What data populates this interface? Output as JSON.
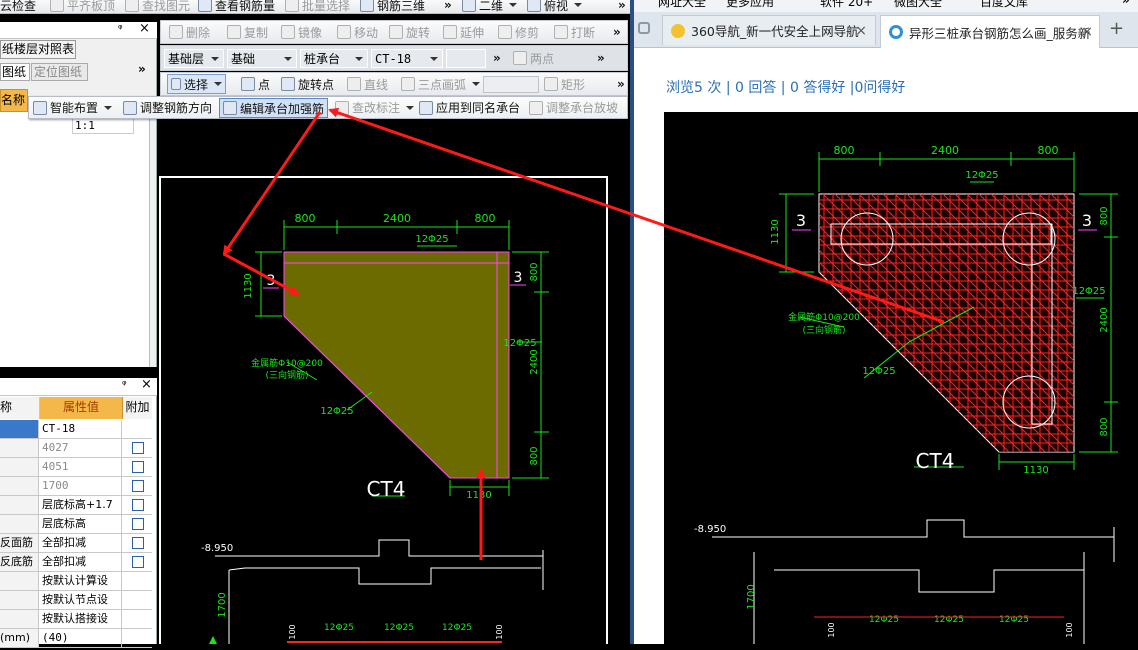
{
  "left_app": {
    "top_toolbar": {
      "items": [
        "云检查",
        "平齐板顶",
        "查找图元",
        "查看钢筋量",
        "批量选择",
        "钢筋三维",
        "二维",
        "俯视"
      ],
      "more": "»"
    },
    "edit_toolbar": {
      "items": [
        "删除",
        "复制",
        "镜像",
        "移动",
        "旋转",
        "延伸",
        "修剪",
        "打断"
      ],
      "more": "»"
    },
    "selector_bar": {
      "floor": "基础层",
      "category": "基础",
      "element_type": "桩承台",
      "element_name": "CT-18",
      "extra_value": "",
      "two_point": "两点",
      "more": "»"
    },
    "draw_toolbar": {
      "items": [
        "选择",
        "点",
        "旋转点",
        "直线",
        "三点画弧",
        "矩形"
      ],
      "more": "»"
    },
    "popup_toolbar": {
      "items": [
        "智能布置",
        "调整钢筋方向",
        "编辑承台加强筋",
        "查改标注",
        "应用到同名承台",
        "调整承台放坡"
      ],
      "highlighted_index": 2
    },
    "left_panel_top": {
      "pin": "ᵠ",
      "close": "×",
      "title": "纸楼层对照表",
      "tabs": [
        "图纸",
        "定位图纸"
      ],
      "more": "»",
      "column_header": "名称",
      "row_value": "1:1"
    },
    "property_panel": {
      "pin": "ᵠ",
      "close": "×",
      "headers": [
        "称",
        "属性值",
        "附加"
      ],
      "rows": [
        {
          "name": "",
          "value": "CT-18",
          "gray": false,
          "checkbox": false,
          "selected": true
        },
        {
          "name": "",
          "value": "4027",
          "gray": true,
          "checkbox": true
        },
        {
          "name": "",
          "value": "4051",
          "gray": true,
          "checkbox": true
        },
        {
          "name": "",
          "value": "1700",
          "gray": true,
          "checkbox": true
        },
        {
          "name": "",
          "value": "层底标高+1.7",
          "gray": false,
          "checkbox": true
        },
        {
          "name": "",
          "value": "层底标高",
          "gray": false,
          "checkbox": true
        },
        {
          "name": "反面筋",
          "value": "全部扣减",
          "gray": false,
          "checkbox": true
        },
        {
          "name": "反底筋",
          "value": "全部扣减",
          "gray": false,
          "checkbox": true
        },
        {
          "name": "",
          "value": "按默认计算设",
          "gray": false,
          "checkbox": false
        },
        {
          "name": "",
          "value": "按默认节点设",
          "gray": false,
          "checkbox": false
        },
        {
          "name": "",
          "value": "按默认搭接设",
          "gray": false,
          "checkbox": false
        },
        {
          "name": "(mm)",
          "value": "(40)",
          "gray": false,
          "checkbox": false
        }
      ]
    },
    "cad": {
      "dims_top": [
        "800",
        "2400",
        "800"
      ],
      "dim_left": "1130",
      "dim_right_top": "800",
      "dim_right_mid": "2400",
      "dim_right_bottom": "800",
      "dim_bottom": "1130",
      "bar_top": "12Φ25",
      "bar_right": "12Φ25",
      "bar_diag": "12Φ25",
      "mesh_note_1": "金属筋Φ10@200",
      "mesh_note_2": "(三向钢筋)",
      "marker": "3",
      "title": "CT4",
      "elev": "-8.950",
      "dim_vertical": "1700",
      "bar_b1": "12Φ25",
      "bar_b2": "12Φ25",
      "bar_b3": "12Φ25",
      "small_100": "100"
    }
  },
  "browser": {
    "toolbar_items": [
      "网址大全",
      "更多应用",
      "软件 20+",
      "微图大全",
      "百度文库"
    ],
    "more": "»",
    "tabs": [
      {
        "title": "360导航_新一代安全上网导航",
        "close": "×",
        "active": false
      },
      {
        "title": "异形三桩承台钢筋怎么画_服务新",
        "close": "×",
        "active": true
      }
    ],
    "new_tab": "+",
    "stats": {
      "views": "浏览5 次",
      "answers": "0 回答",
      "good": "0 答得好",
      "ask_good": "0问得好",
      "sep": "|"
    },
    "cad": {
      "dims_top": [
        "800",
        "2400",
        "800"
      ],
      "dim_left": "1130",
      "dim_right_top": "800",
      "dim_right_mid": "2400",
      "dim_right_bottom": "800",
      "dim_bottom": "1130",
      "bar_top": "12Φ25",
      "bar_right": "12Φ25",
      "bar_diag": "12Φ25",
      "mesh_note_1": "金属筋Φ10@200",
      "mesh_note_2": "(三向钢筋)",
      "marker": "3",
      "title": "CT4",
      "elev": "-8.950",
      "dim_vertical": "1700",
      "bar_b1": "12Φ25",
      "bar_b2": "12Φ25",
      "bar_b3": "12Φ25",
      "small_100": "100"
    }
  },
  "colors": {
    "annotation_red": "#ff1a1a",
    "cad_green": "#19e619",
    "olive_fill": "#6b6b00",
    "cad_magenta": "#ff44ff",
    "link_blue": "#2a6fb7"
  }
}
